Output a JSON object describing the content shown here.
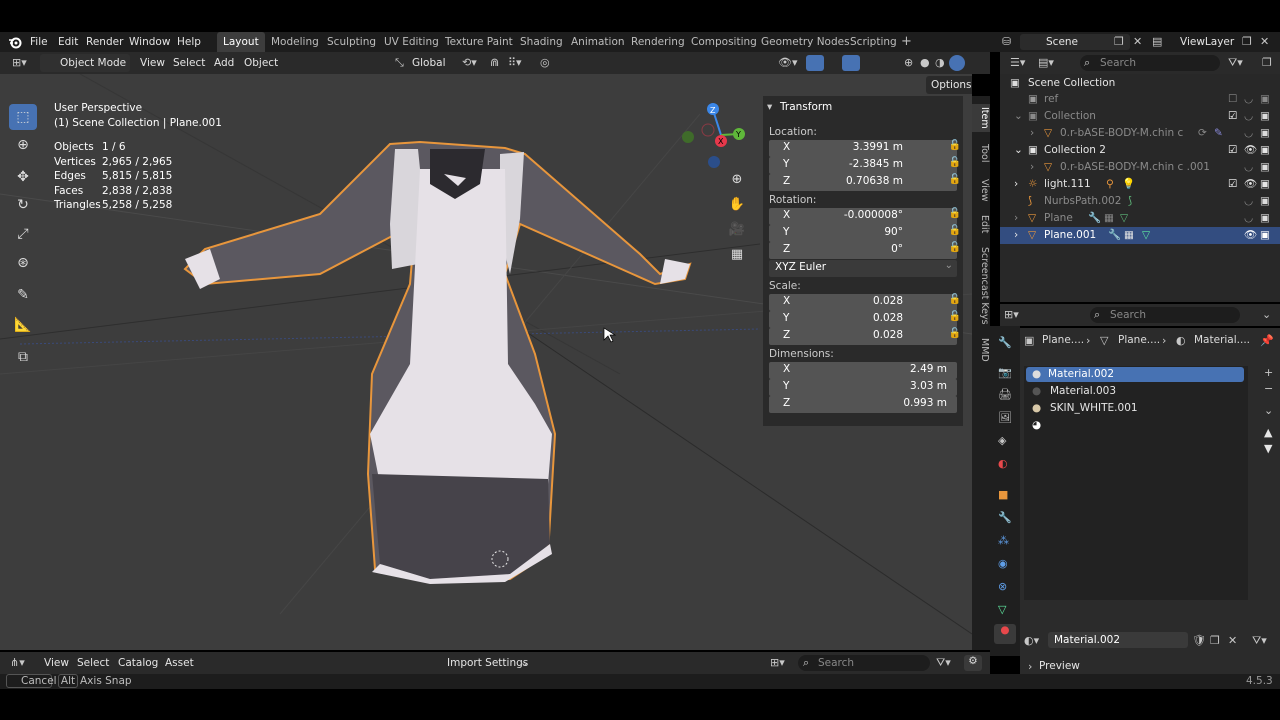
{
  "top_menu": {
    "items": [
      "File",
      "Edit",
      "Render",
      "Window",
      "Help"
    ]
  },
  "workspaces": {
    "tabs": [
      "Layout",
      "Modeling",
      "Sculpting",
      "UV Editing",
      "Texture Paint",
      "Shading",
      "Animation",
      "Rendering",
      "Compositing",
      "Geometry Nodes",
      "Scripting"
    ],
    "active": "Layout",
    "add": "+"
  },
  "scene": {
    "name": "Scene",
    "view_layer": "ViewLayer"
  },
  "vp_header": {
    "mode": "Object Mode",
    "menus": [
      "View",
      "Select",
      "Add",
      "Object"
    ],
    "orientation": "Global",
    "options": "Options"
  },
  "overlay": {
    "view_name": "User Perspective",
    "collection_line": "(1) Scene Collection | Plane.001",
    "stats": [
      {
        "label": "Objects",
        "value": "1 / 6"
      },
      {
        "label": "Vertices",
        "value": "2,965 / 2,965"
      },
      {
        "label": "Edges",
        "value": "5,815 / 5,815"
      },
      {
        "label": "Faces",
        "value": "2,838 / 2,838"
      },
      {
        "label": "Triangles",
        "value": "5,258 / 5,258"
      }
    ]
  },
  "gizmo": {
    "x": "X",
    "y": "Y",
    "z": "Z"
  },
  "transform": {
    "title": "Transform",
    "location_label": "Location:",
    "location": [
      {
        "axis": "X",
        "value": "3.3991 m"
      },
      {
        "axis": "Y",
        "value": "-2.3845 m"
      },
      {
        "axis": "Z",
        "value": "0.70638 m"
      }
    ],
    "rotation_label": "Rotation:",
    "rotation": [
      {
        "axis": "X",
        "value": "-0.000008°"
      },
      {
        "axis": "Y",
        "value": "90°"
      },
      {
        "axis": "Z",
        "value": "0°"
      }
    ],
    "rotation_mode": "XYZ Euler",
    "scale_label": "Scale:",
    "scale": [
      {
        "axis": "X",
        "value": "0.028"
      },
      {
        "axis": "Y",
        "value": "0.028"
      },
      {
        "axis": "Z",
        "value": "0.028"
      }
    ],
    "dimensions_label": "Dimensions:",
    "dimensions": [
      {
        "axis": "X",
        "value": "2.49 m"
      },
      {
        "axis": "Y",
        "value": "3.03 m"
      },
      {
        "axis": "Z",
        "value": "0.993 m"
      }
    ]
  },
  "side_tabs": [
    "Item",
    "Tool",
    "View",
    "Edit",
    "Screencast Keys",
    "MMD"
  ],
  "outliner": {
    "search_placeholder": "Search",
    "rows": [
      {
        "label": "Scene Collection",
        "indent": 0
      },
      {
        "label": "ref",
        "indent": 1
      },
      {
        "label": "Collection",
        "indent": 1
      },
      {
        "label": "0.r-bASE-BODY-M.chin c",
        "indent": 2
      },
      {
        "label": "Collection 2",
        "indent": 1
      },
      {
        "label": "0.r-bASE-BODY-M.chin c .001",
        "indent": 2
      },
      {
        "label": "light.111",
        "indent": 1
      },
      {
        "label": "NurbsPath.002",
        "indent": 1
      },
      {
        "label": "Plane",
        "indent": 1
      },
      {
        "label": "Plane.001",
        "indent": 1,
        "selected": true
      }
    ]
  },
  "properties": {
    "search_placeholder": "Search",
    "breadcrumb": [
      "Plane....",
      "Plane....",
      "Material...."
    ],
    "materials": [
      "Material.002",
      "Material.003",
      "SKIN_WHITE.001"
    ],
    "active_material": "Material.002",
    "preview_label": "Preview"
  },
  "asset_bar": {
    "menus": [
      "View",
      "Select",
      "Catalog",
      "Asset"
    ],
    "import": "Import Settings",
    "search_placeholder": "Search"
  },
  "status_bar": {
    "cancel": "Cancel",
    "alt_key": "Alt",
    "axis_snap": "Axis Snap",
    "version": "4.5.3"
  },
  "colors": {
    "selected_row": "#334d80",
    "active_material": "#4772b3",
    "object_outline": "#e8963c",
    "viewport_bg": "#3d3d3d"
  }
}
